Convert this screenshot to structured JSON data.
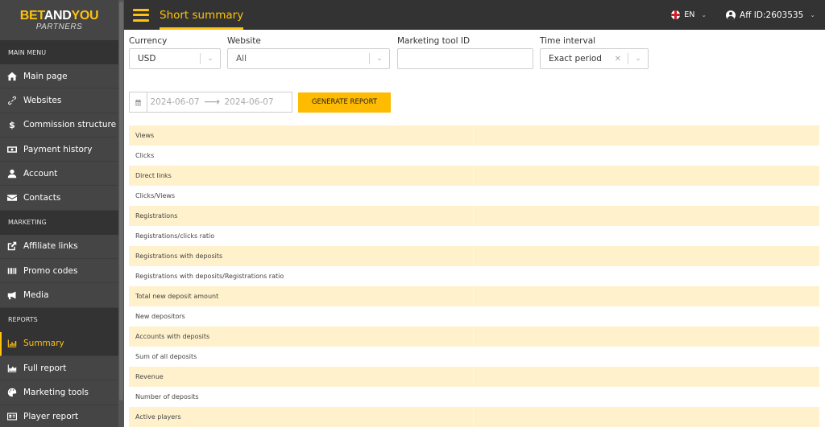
{
  "brand": {
    "logo_part1": "BET",
    "logo_part2": "AND",
    "logo_part3": "YOU",
    "logo_sub": "PARTNERS",
    "accent_color": "#ffc20e"
  },
  "sidebar": {
    "sections": [
      {
        "title": "MAIN MENU",
        "items": [
          {
            "label": "Main page",
            "icon": "home-icon",
            "active": false
          },
          {
            "label": "Websites",
            "icon": "link-icon",
            "active": false
          },
          {
            "label": "Commission structure",
            "icon": "dollar-icon",
            "active": false
          },
          {
            "label": "Payment history",
            "icon": "money-bill-icon",
            "active": false
          },
          {
            "label": "Account",
            "icon": "user-icon",
            "active": false
          },
          {
            "label": "Contacts",
            "icon": "envelope-icon",
            "active": false
          }
        ]
      },
      {
        "title": "MARKETING",
        "items": [
          {
            "label": "Affiliate links",
            "icon": "external-link-icon",
            "active": false
          },
          {
            "label": "Promo codes",
            "icon": "barcode-icon",
            "active": false
          },
          {
            "label": "Media",
            "icon": "megaphone-icon",
            "active": false
          }
        ]
      },
      {
        "title": "REPORTS",
        "items": [
          {
            "label": "Summary",
            "icon": "bar-chart-icon",
            "active": true
          },
          {
            "label": "Full report",
            "icon": "area-chart-icon",
            "active": false
          },
          {
            "label": "Marketing tools",
            "icon": "palette-icon",
            "active": false
          },
          {
            "label": "Player report",
            "icon": "id-card-icon",
            "active": false
          }
        ]
      }
    ]
  },
  "header": {
    "title": "Short summary",
    "language": "EN",
    "user_label": "Aff ID:2603535"
  },
  "filters": {
    "currency": {
      "label": "Currency",
      "value": "USD"
    },
    "website": {
      "label": "Website",
      "value": "All"
    },
    "marketing_tool_id": {
      "label": "Marketing tool ID",
      "value": "",
      "placeholder": ""
    },
    "time_interval": {
      "label": "Time interval",
      "value": "Exact period"
    },
    "date_from": "2024-06-07",
    "date_to": "2024-06-07",
    "generate_label": "GENERATE REPORT"
  },
  "summary": {
    "rows": [
      {
        "label": "Views",
        "value": ""
      },
      {
        "label": "Clicks",
        "value": ""
      },
      {
        "label": "Direct links",
        "value": ""
      },
      {
        "label": "Clicks/Views",
        "value": ""
      },
      {
        "label": "Registrations",
        "value": ""
      },
      {
        "label": "Registrations/clicks ratio",
        "value": ""
      },
      {
        "label": "Registrations with deposits",
        "value": ""
      },
      {
        "label": "Registrations with deposits/Registrations ratio",
        "value": ""
      },
      {
        "label": "Total new deposit amount",
        "value": ""
      },
      {
        "label": "New depositors",
        "value": ""
      },
      {
        "label": "Accounts with deposits",
        "value": ""
      },
      {
        "label": "Sum of all deposits",
        "value": ""
      },
      {
        "label": "Revenue",
        "value": ""
      },
      {
        "label": "Number of deposits",
        "value": ""
      },
      {
        "label": "Active players",
        "value": ""
      }
    ]
  }
}
